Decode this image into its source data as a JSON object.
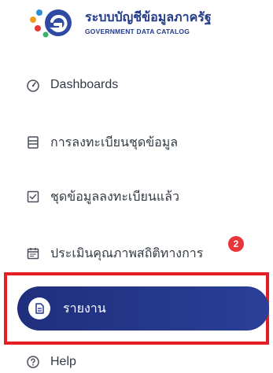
{
  "logo": {
    "title_th": "ระบบบัญชีข้อมูลภาครัฐ",
    "title_en": "GOVERNMENT DATA CATALOG"
  },
  "nav": {
    "items": [
      {
        "label": "Dashboards",
        "icon": "gauge-icon"
      },
      {
        "label": "การลงทะเบียนชุดข้อมูล",
        "icon": "document-list-icon"
      },
      {
        "label": "ชุดข้อมูลลงทะเบียนแล้ว",
        "icon": "checkbox-icon"
      },
      {
        "label": "ประเมินคุณภาพสถิติทางการ",
        "icon": "calendar-icon",
        "badge": "2"
      },
      {
        "label": "รายงาน",
        "icon": "report-icon",
        "active": true
      },
      {
        "label": "Help",
        "icon": "help-icon"
      }
    ]
  },
  "colors": {
    "active_bg": "#22338a",
    "highlight_border": "#e41e23",
    "badge": "#e8353a",
    "brand": "#233c8a"
  }
}
